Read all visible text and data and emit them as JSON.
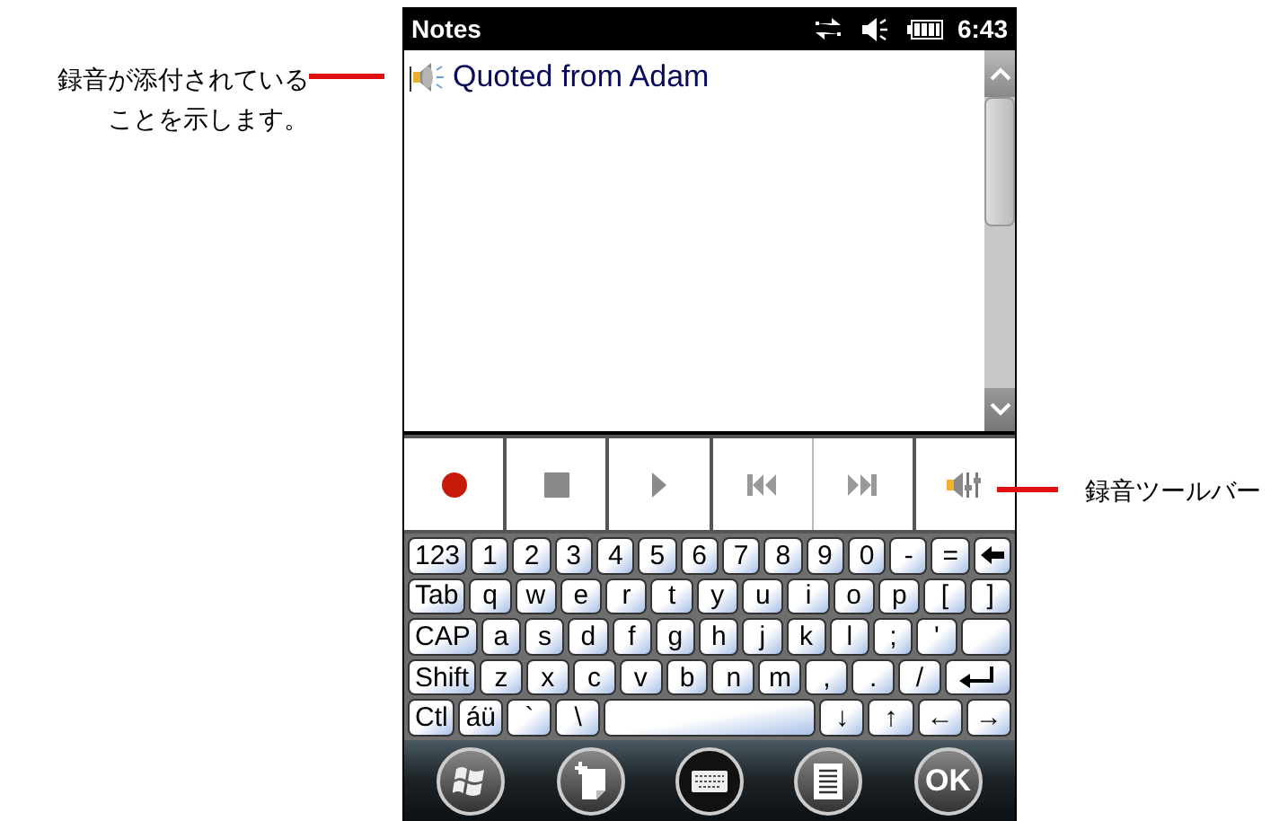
{
  "status_bar": {
    "title": "Notes",
    "time": "6:43"
  },
  "note": {
    "title": "Quoted from Adam",
    "has_recording": true
  },
  "recording_toolbar": {
    "buttons": [
      {
        "kind": "record"
      },
      {
        "kind": "stop"
      },
      {
        "kind": "play"
      },
      {
        "kind": "previous"
      },
      {
        "kind": "next"
      },
      {
        "kind": "volume"
      }
    ]
  },
  "keyboard": {
    "key_lines": [
      [
        {
          "kind": "mod",
          "label": "123"
        },
        {
          "kind": "char",
          "label": "1"
        },
        {
          "kind": "char",
          "label": "2"
        },
        {
          "kind": "char",
          "label": "3"
        },
        {
          "kind": "char",
          "label": "4"
        },
        {
          "kind": "char",
          "label": "5"
        },
        {
          "kind": "char",
          "label": "6"
        },
        {
          "kind": "char",
          "label": "7"
        },
        {
          "kind": "char",
          "label": "8"
        },
        {
          "kind": "char",
          "label": "9"
        },
        {
          "kind": "char",
          "label": "0"
        },
        {
          "kind": "char",
          "label": "-"
        },
        {
          "kind": "char",
          "label": "="
        },
        {
          "kind": "backspace"
        }
      ],
      [
        {
          "kind": "mod",
          "label": "Tab"
        },
        {
          "kind": "char",
          "label": "q"
        },
        {
          "kind": "char",
          "label": "w"
        },
        {
          "kind": "char",
          "label": "e"
        },
        {
          "kind": "char",
          "label": "r"
        },
        {
          "kind": "char",
          "label": "t"
        },
        {
          "kind": "char",
          "label": "y"
        },
        {
          "kind": "char",
          "label": "u"
        },
        {
          "kind": "char",
          "label": "i"
        },
        {
          "kind": "char",
          "label": "o"
        },
        {
          "kind": "char",
          "label": "p"
        },
        {
          "kind": "char",
          "label": "["
        },
        {
          "kind": "char",
          "label": "]"
        }
      ],
      [
        {
          "kind": "mod",
          "label": "CAP"
        },
        {
          "kind": "char",
          "label": "a"
        },
        {
          "kind": "char",
          "label": "s"
        },
        {
          "kind": "char",
          "label": "d"
        },
        {
          "kind": "char",
          "label": "f"
        },
        {
          "kind": "char",
          "label": "g"
        },
        {
          "kind": "char",
          "label": "h"
        },
        {
          "kind": "char",
          "label": "j"
        },
        {
          "kind": "char",
          "label": "k"
        },
        {
          "kind": "char",
          "label": "l"
        },
        {
          "kind": "char",
          "label": ";"
        },
        {
          "kind": "char",
          "label": "'"
        },
        {
          "kind": "blank"
        }
      ],
      [
        {
          "kind": "mod",
          "label": "Shift"
        },
        {
          "kind": "char",
          "label": "z"
        },
        {
          "kind": "char",
          "label": "x"
        },
        {
          "kind": "char",
          "label": "c"
        },
        {
          "kind": "char",
          "label": "v"
        },
        {
          "kind": "char",
          "label": "b"
        },
        {
          "kind": "char",
          "label": "n"
        },
        {
          "kind": "char",
          "label": "m"
        },
        {
          "kind": "char",
          "label": ","
        },
        {
          "kind": "char",
          "label": "."
        },
        {
          "kind": "char",
          "label": "/"
        },
        {
          "kind": "enter"
        }
      ],
      [
        {
          "kind": "mod",
          "label": "Ctl"
        },
        {
          "kind": "mod",
          "label": "áü"
        },
        {
          "kind": "char",
          "label": "`"
        },
        {
          "kind": "char",
          "label": "\\"
        },
        {
          "kind": "space"
        },
        {
          "kind": "char",
          "label": "↓"
        },
        {
          "kind": "char",
          "label": "↑"
        },
        {
          "kind": "char",
          "label": "←"
        },
        {
          "kind": "char",
          "label": "→"
        }
      ]
    ]
  },
  "softkeys": [
    {
      "kind": "start",
      "selected": false
    },
    {
      "kind": "new",
      "selected": false
    },
    {
      "kind": "keyboard",
      "selected": true
    },
    {
      "kind": "menu",
      "selected": false
    },
    {
      "kind": "text",
      "label": "OK",
      "selected": false
    }
  ],
  "annotations": [
    {
      "kind": "left",
      "text": "録音が添付されていることを示します。"
    },
    {
      "kind": "right",
      "text": "録音ツールバー"
    }
  ]
}
